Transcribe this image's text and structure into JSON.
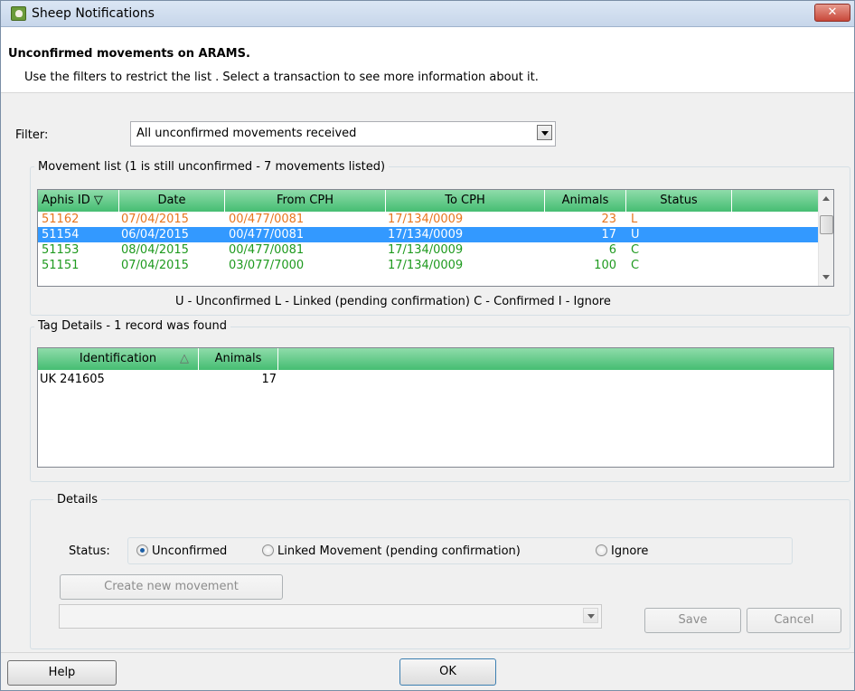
{
  "window": {
    "title": "Sheep Notifications",
    "close_glyph": "✕",
    "app_icon": "sheep-icon"
  },
  "header": {
    "title": "Unconfirmed movements on ARAMS.",
    "subtitle": "Use the filters to restrict the list . Select a transaction to see more information about it."
  },
  "filter": {
    "label": "Filter:",
    "value": "All unconfirmed movements received"
  },
  "movement_list": {
    "group_title": "Movement list  (1 is still unconfirmed - 7 movements listed)",
    "columns": [
      "Aphis ID ▽",
      "Date",
      "From CPH",
      "To CPH",
      "Animals",
      "Status"
    ],
    "rows": [
      {
        "aphis_id": "51162",
        "date": "07/04/2015",
        "from_cph": "00/477/0081",
        "to_cph": "17/134/0009",
        "animals": "23",
        "status": "L",
        "color": "#e8761e",
        "selected": false
      },
      {
        "aphis_id": "51154",
        "date": "06/04/2015",
        "from_cph": "00/477/0081",
        "to_cph": "17/134/0009",
        "animals": "17",
        "status": "U",
        "color": "#ffffff",
        "selected": true
      },
      {
        "aphis_id": "51153",
        "date": "08/04/2015",
        "from_cph": "00/477/0081",
        "to_cph": "17/134/0009",
        "animals": "6",
        "status": "C",
        "color": "#1f9a1f",
        "selected": false
      },
      {
        "aphis_id": "51151",
        "date": "07/04/2015",
        "from_cph": "03/077/7000",
        "to_cph": "17/134/0009",
        "animals": "100",
        "status": "C",
        "color": "#1f9a1f",
        "selected": false
      }
    ],
    "legend": "U - Unconfirmed   L - Linked (pending confirmation)    C - Confirmed    I - Ignore"
  },
  "tag_details": {
    "group_title": "Tag Details - 1 record was found",
    "columns": [
      "Identification",
      "Animals"
    ],
    "sort_glyph": "△",
    "rows": [
      {
        "identification": "UK 241605",
        "animals": "17"
      }
    ]
  },
  "details": {
    "group_title": "Details",
    "status_label": "Status:",
    "status_options": [
      {
        "label": "Unconfirmed",
        "checked": true
      },
      {
        "label": "Linked Movement (pending confirmation)",
        "checked": false
      },
      {
        "label": "Ignore",
        "checked": false
      }
    ],
    "create_button": "Create new movement",
    "save_button": "Save",
    "cancel_button": "Cancel",
    "movement_combo_value": ""
  },
  "footer": {
    "help_button": "Help",
    "ok_button": "OK"
  },
  "colors": {
    "grid_header": "#45bd72",
    "selection": "#3399ff",
    "linked": "#e8761e",
    "confirmed": "#1f9a1f"
  }
}
